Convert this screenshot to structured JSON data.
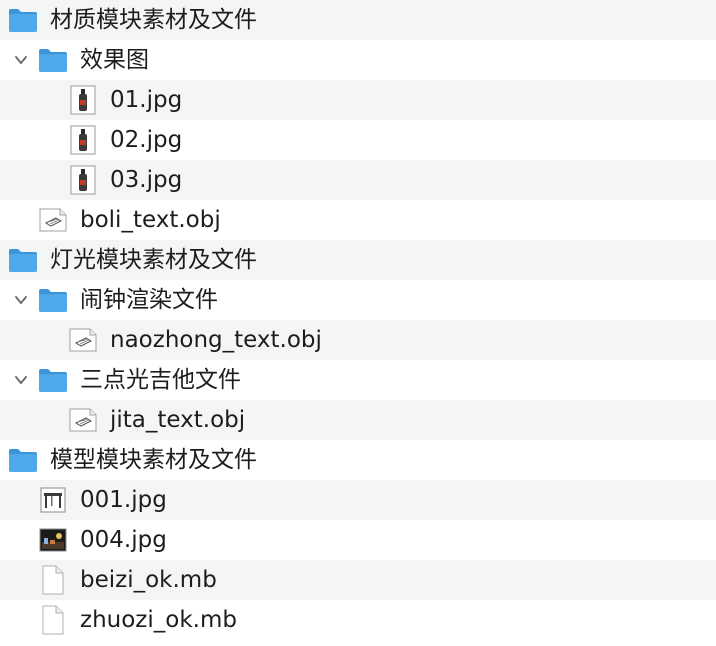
{
  "tree": {
    "rows": [
      {
        "label": "材质模块素材及文件",
        "icon": "folder-icon",
        "expanded": null,
        "depth": 0
      },
      {
        "label": "效果图",
        "icon": "folder-icon",
        "expanded": true,
        "depth": 1
      },
      {
        "label": "01.jpg",
        "icon": "bottle-image-thumbnail-icon",
        "expanded": null,
        "depth": 2
      },
      {
        "label": "02.jpg",
        "icon": "bottle-image-thumbnail-icon",
        "expanded": null,
        "depth": 2
      },
      {
        "label": "03.jpg",
        "icon": "bottle-image-thumbnail-icon",
        "expanded": null,
        "depth": 2
      },
      {
        "label": "boli_text.obj",
        "icon": "obj-file-icon",
        "expanded": null,
        "depth": 1
      },
      {
        "label": "灯光模块素材及文件",
        "icon": "folder-icon",
        "expanded": null,
        "depth": 0
      },
      {
        "label": "闹钟渲染文件",
        "icon": "folder-icon",
        "expanded": true,
        "depth": 1
      },
      {
        "label": "naozhong_text.obj",
        "icon": "obj-file-icon",
        "expanded": null,
        "depth": 2
      },
      {
        "label": "三点光吉他文件",
        "icon": "folder-icon",
        "expanded": true,
        "depth": 1
      },
      {
        "label": "jita_text.obj",
        "icon": "obj-file-icon",
        "expanded": null,
        "depth": 2
      },
      {
        "label": "模型模块素材及文件",
        "icon": "folder-icon",
        "expanded": null,
        "depth": 0
      },
      {
        "label": "001.jpg",
        "icon": "table-image-thumbnail-icon",
        "expanded": null,
        "depth": 1
      },
      {
        "label": "004.jpg",
        "icon": "scene-image-thumbnail-icon",
        "expanded": null,
        "depth": 1
      },
      {
        "label": "beizi_ok.mb",
        "icon": "blank-file-icon",
        "expanded": null,
        "depth": 1
      },
      {
        "label": "zhuozi_ok.mb",
        "icon": "blank-file-icon",
        "expanded": null,
        "depth": 1
      }
    ]
  },
  "colors": {
    "folder": "#4fa8ea",
    "folder_tab": "#3c95d8",
    "stripe": "#f4f5f5",
    "text": "#1d1d1f",
    "chevron": "#6e6e73"
  }
}
